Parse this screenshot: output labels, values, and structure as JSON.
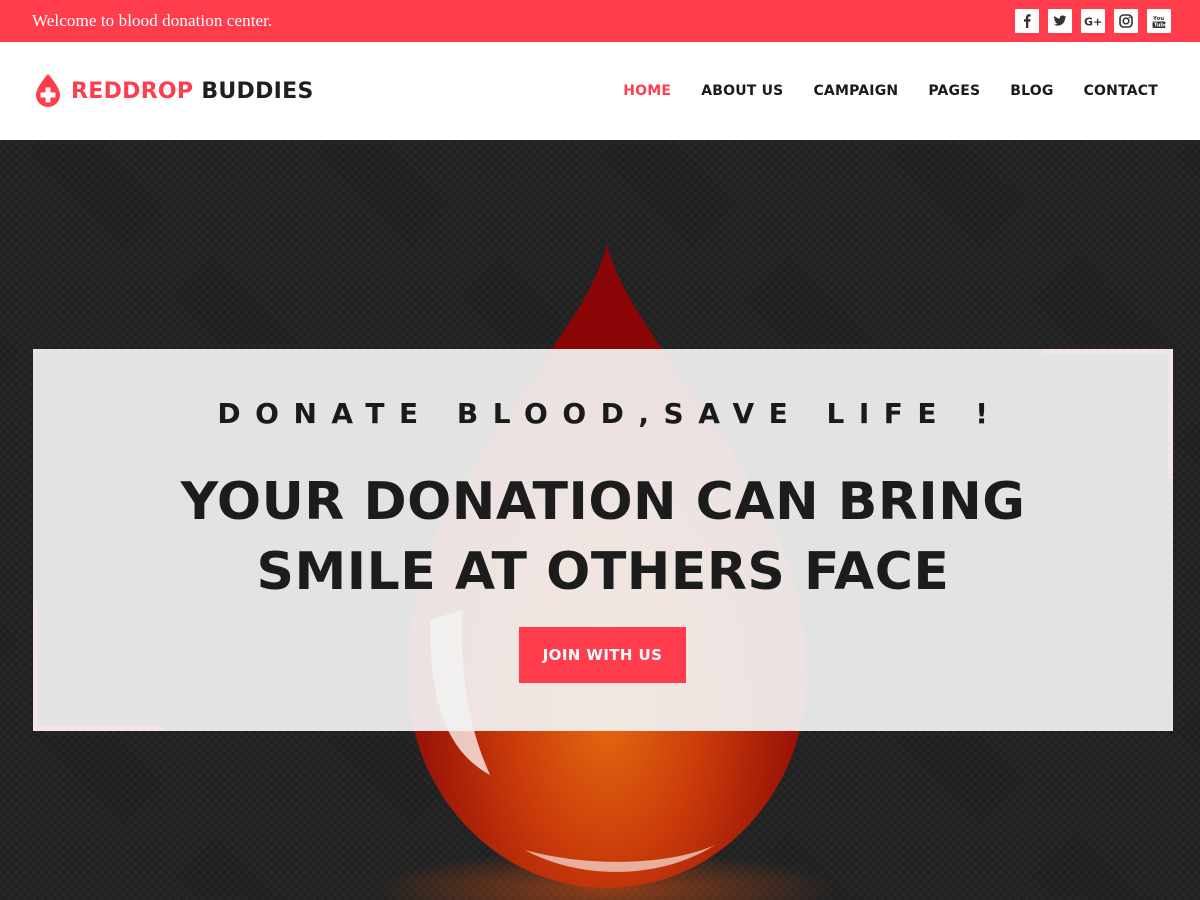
{
  "topbar": {
    "welcome_text": "Welcome to blood donation center.",
    "socials": [
      {
        "icon": "facebook-icon"
      },
      {
        "icon": "twitter-icon"
      },
      {
        "icon": "google-plus-icon"
      },
      {
        "icon": "instagram-icon"
      },
      {
        "icon": "youtube-icon"
      }
    ]
  },
  "header": {
    "logo": {
      "part1": "REDDROP",
      "part2": "BUDDIES"
    },
    "nav": [
      {
        "label": "HOME",
        "active": true
      },
      {
        "label": "ABOUT US"
      },
      {
        "label": "CAMPAIGN"
      },
      {
        "label": "PAGES"
      },
      {
        "label": "BLOG"
      },
      {
        "label": "CONTACT"
      }
    ]
  },
  "hero": {
    "kicker": "DONATE BLOOD,SAVE LIFE !",
    "headline_line1": "YOUR DONATION CAN BRING",
    "headline_line2": "SMILE AT OTHERS FACE",
    "cta_label": "JOIN WITH US"
  },
  "colors": {
    "accent": "#ff3d4d",
    "topbar_bg": "#ff3d4d",
    "hero_bg": "#232323",
    "text_dark": "#1c1c1c"
  }
}
